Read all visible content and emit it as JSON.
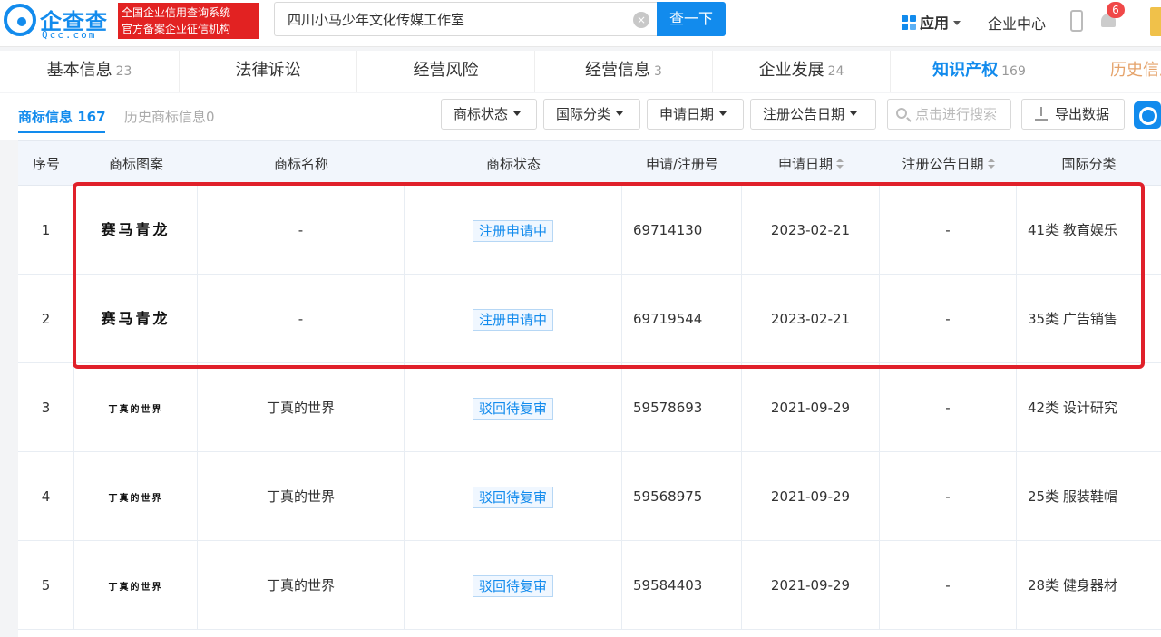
{
  "header": {
    "logo_cn": "企查查",
    "logo_en": "Qcc.com",
    "slogan_line1": "全国企业信用查询系统",
    "slogan_line2": "官方备案企业征信机构",
    "search_value": "四川小马少年文化传媒工作室",
    "search_button": "查一下",
    "apps_label": "应用",
    "enterprise_center": "企业中心",
    "notification_count": "6"
  },
  "tabs": [
    {
      "label": "基本信息",
      "count": "23"
    },
    {
      "label": "法律诉讼",
      "count": ""
    },
    {
      "label": "经营风险",
      "count": ""
    },
    {
      "label": "经营信息",
      "count": "3"
    },
    {
      "label": "企业发展",
      "count": "24"
    },
    {
      "label": "知识产权",
      "count": "169"
    },
    {
      "label": "历史信息",
      "count": ""
    }
  ],
  "subtabs": {
    "active_label": "商标信息",
    "active_count": "167",
    "inactive_label": "历史商标信息",
    "inactive_count": "0"
  },
  "filters": [
    "商标状态",
    "国际分类",
    "申请日期",
    "注册公告日期"
  ],
  "search_placeholder": "点击进行搜索",
  "export_label": "导出数据",
  "table": {
    "columns": [
      "序号",
      "商标图案",
      "商标名称",
      "商标状态",
      "申请/注册号",
      "申请日期",
      "注册公告日期",
      "国际分类"
    ],
    "rows": [
      {
        "no": "1",
        "image_text": "赛马青龙",
        "name": "-",
        "status": "注册申请中",
        "reg_no": "69714130",
        "apply_date": "2023-02-21",
        "announce_date": "-",
        "class": "41类 教育娱乐"
      },
      {
        "no": "2",
        "image_text": "赛马青龙",
        "name": "-",
        "status": "注册申请中",
        "reg_no": "69719544",
        "apply_date": "2023-02-21",
        "announce_date": "-",
        "class": "35类 广告销售"
      },
      {
        "no": "3",
        "image_text": "丁真的世界",
        "name": "丁真的世界",
        "status": "驳回待复审",
        "reg_no": "59578693",
        "apply_date": "2021-09-29",
        "announce_date": "-",
        "class": "42类 设计研究"
      },
      {
        "no": "4",
        "image_text": "丁真的世界",
        "name": "丁真的世界",
        "status": "驳回待复审",
        "reg_no": "59568975",
        "apply_date": "2021-09-29",
        "announce_date": "-",
        "class": "25类 服装鞋帽"
      },
      {
        "no": "5",
        "image_text": "丁真的世界",
        "name": "丁真的世界",
        "status": "驳回待复审",
        "reg_no": "59584403",
        "apply_date": "2021-09-29",
        "announce_date": "-",
        "class": "28类 健身器材"
      }
    ]
  },
  "colors": {
    "brand_blue": "#128bed",
    "highlight_red": "#e0202a",
    "slogan_red": "#e22222"
  }
}
